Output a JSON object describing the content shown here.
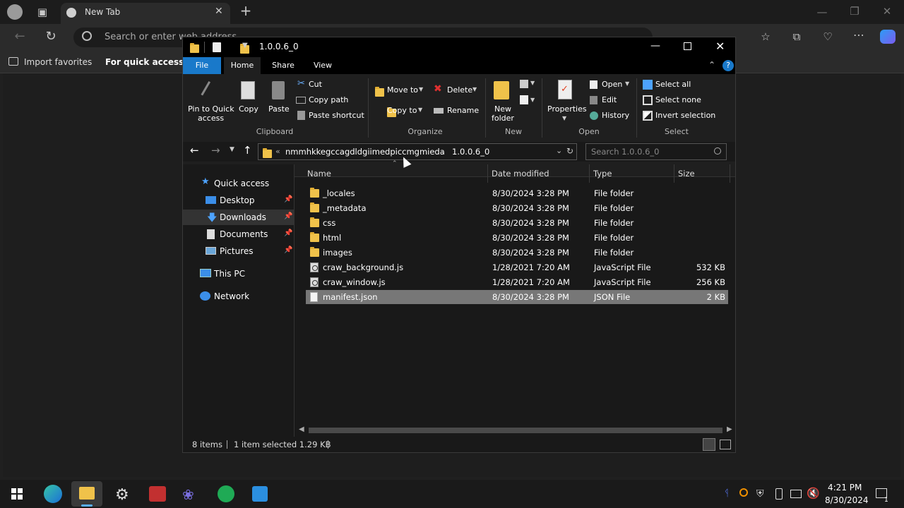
{
  "browser": {
    "tab_title": "New Tab",
    "address_placeholder": "Search or enter web address",
    "favorites": {
      "import_label": "Import favorites",
      "hint": "For quick access, pla"
    }
  },
  "explorer": {
    "title": "1.0.0.6_0",
    "ribbon_tabs": [
      "File",
      "Home",
      "Share",
      "View"
    ],
    "clipboard": {
      "pin_label_1": "Pin to Quick",
      "pin_label_2": "access",
      "copy": "Copy",
      "paste": "Paste",
      "cut": "Cut",
      "copy_path": "Copy path",
      "paste_shortcut": "Paste shortcut",
      "group": "Clipboard"
    },
    "organize": {
      "move_to": "Move to",
      "copy_to": "Copy to",
      "delete": "Delete",
      "rename": "Rename",
      "group": "Organize"
    },
    "new": {
      "new_folder_1": "New",
      "new_folder_2": "folder",
      "group": "New"
    },
    "open": {
      "properties": "Properties",
      "open": "Open",
      "edit": "Edit",
      "history": "History",
      "group": "Open"
    },
    "select": {
      "select_all": "Select all",
      "select_none": "Select none",
      "invert": "Invert selection",
      "group": "Select"
    },
    "breadcrumb": {
      "overflow": "«",
      "parent": "nmmhkkegccagdldgiimedpiccmgmieda",
      "current": "1.0.0.6_0"
    },
    "search_placeholder": "Search 1.0.0.6_0",
    "nav": {
      "quick_access": "Quick access",
      "desktop": "Desktop",
      "downloads": "Downloads",
      "documents": "Documents",
      "pictures": "Pictures",
      "this_pc": "This PC",
      "network": "Network"
    },
    "columns": {
      "name": "Name",
      "date": "Date modified",
      "type": "Type",
      "size": "Size"
    },
    "files": [
      {
        "name": "_locales",
        "date": "8/30/2024 3:28 PM",
        "type": "File folder",
        "size": "",
        "kind": "folder"
      },
      {
        "name": "_metadata",
        "date": "8/30/2024 3:28 PM",
        "type": "File folder",
        "size": "",
        "kind": "folder"
      },
      {
        "name": "css",
        "date": "8/30/2024 3:28 PM",
        "type": "File folder",
        "size": "",
        "kind": "folder"
      },
      {
        "name": "html",
        "date": "8/30/2024 3:28 PM",
        "type": "File folder",
        "size": "",
        "kind": "folder"
      },
      {
        "name": "images",
        "date": "8/30/2024 3:28 PM",
        "type": "File folder",
        "size": "",
        "kind": "folder"
      },
      {
        "name": "craw_background.js",
        "date": "1/28/2021 7:20 AM",
        "type": "JavaScript File",
        "size": "532 KB",
        "kind": "js"
      },
      {
        "name": "craw_window.js",
        "date": "1/28/2021 7:20 AM",
        "type": "JavaScript File",
        "size": "256 KB",
        "kind": "js"
      },
      {
        "name": "manifest.json",
        "date": "8/30/2024 3:28 PM",
        "type": "JSON File",
        "size": "2 KB",
        "kind": "file"
      }
    ],
    "status": {
      "items": "8 items",
      "selected": "1 item selected 1.29 KB"
    }
  },
  "taskbar": {
    "time": "4:21 PM",
    "date": "8/30/2024",
    "notif_count": "1"
  },
  "colors": {
    "accent": "#1979ca",
    "folder": "#f0c24a",
    "selection": "#777777"
  }
}
